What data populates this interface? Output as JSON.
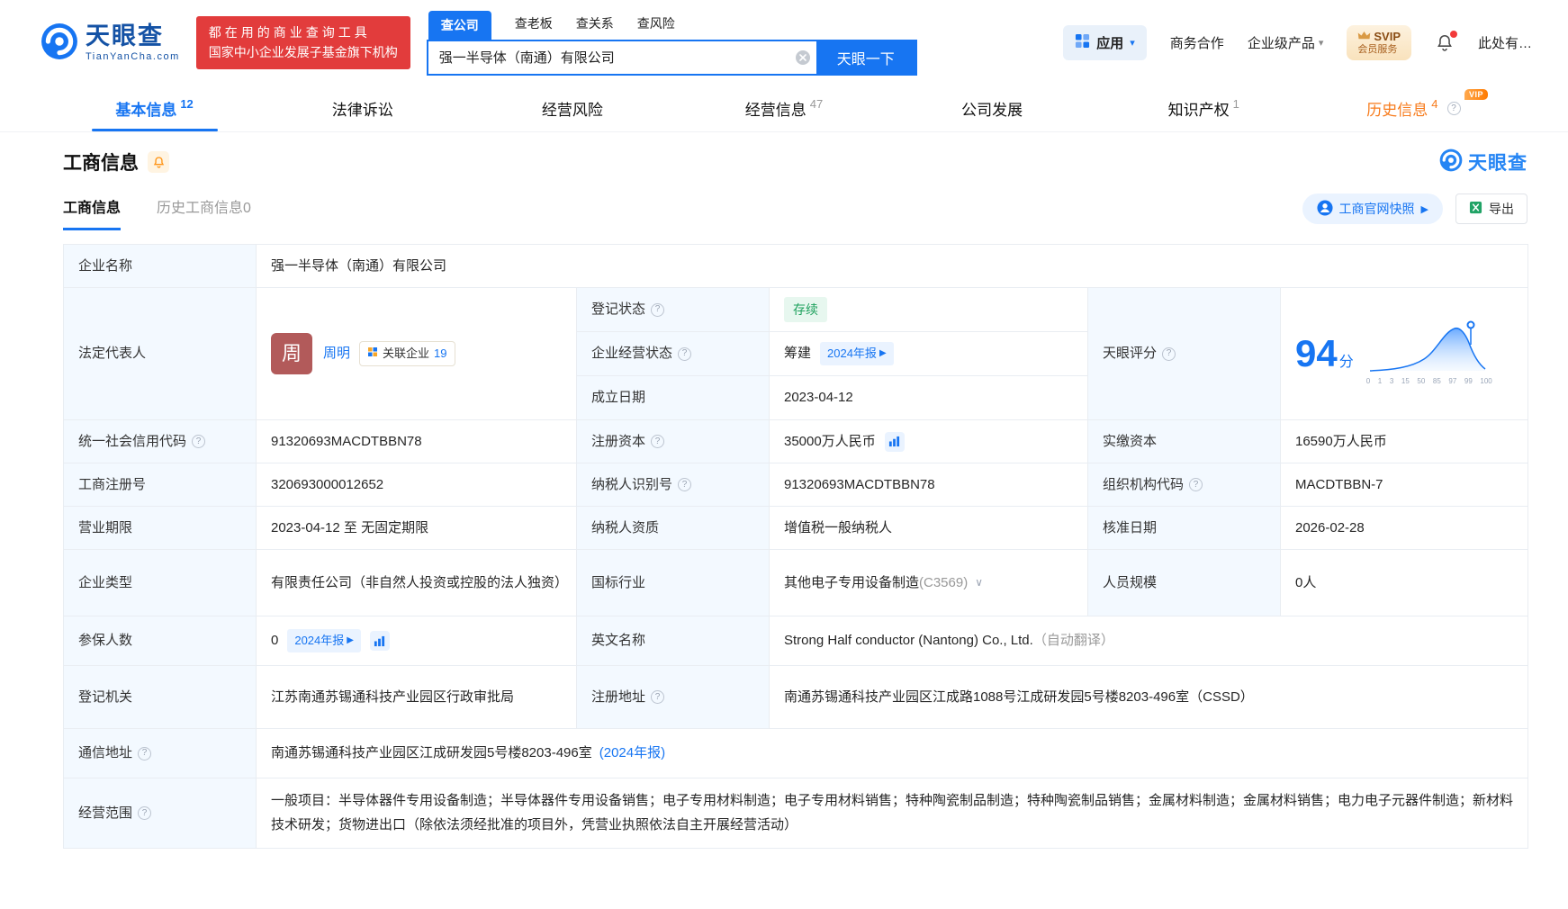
{
  "colors": {
    "accent": "#1775F2",
    "green": "#1EA15D",
    "orange": "#F77B1C",
    "red": "#E23C3C"
  },
  "header": {
    "logo": {
      "brand": "天眼查",
      "domain": "TianYanCha.com"
    },
    "slogan": {
      "line1": "都在用的商业查询工具",
      "line2": "国家中小企业发展子基金旗下机构"
    },
    "search": {
      "tabs": [
        {
          "label": "查公司"
        },
        {
          "label": "查老板"
        },
        {
          "label": "查关系"
        },
        {
          "label": "查风险"
        }
      ],
      "value": "强一半导体（南通）有限公司",
      "button": "天眼一下"
    },
    "menu": {
      "apps": "应用",
      "cooperation": "商务合作",
      "enterprise": "企业级产品",
      "svip_line1": "SVIP",
      "svip_line2": "会员服务",
      "more": "此处有…"
    }
  },
  "nav_tabs": [
    {
      "label": "基本信息",
      "count": "12"
    },
    {
      "label": "法律诉讼",
      "count": ""
    },
    {
      "label": "经营风险",
      "count": ""
    },
    {
      "label": "经营信息",
      "count": "47"
    },
    {
      "label": "公司发展",
      "count": ""
    },
    {
      "label": "知识产权",
      "count": "1"
    },
    {
      "label": "历史信息",
      "count": "4",
      "vip_tag": "VIP"
    }
  ],
  "section": {
    "title": "工商信息",
    "watermark": "天眼查"
  },
  "subtabs": {
    "current": "工商信息",
    "history": "历史工商信息0",
    "snapshot_button": "工商官网快照",
    "export_button": "导出"
  },
  "table": {
    "company_name_label": "企业名称",
    "company_name": "强一半导体（南通）有限公司",
    "legal_rep_label": "法定代表人",
    "legal_rep_avatar": "周",
    "legal_rep_name": "周明",
    "related_companies_label": "关联企业",
    "related_companies_count": "19",
    "reg_status_label": "登记状态",
    "reg_status": "存续",
    "operating_status_label": "企业经营状态",
    "operating_status": "筹建",
    "annual_report_badge": "2024年报",
    "establish_date_label": "成立日期",
    "establish_date": "2023-04-12",
    "score_label": "天眼评分",
    "score": "94",
    "score_unit": "分",
    "score_axis": [
      "0",
      "1",
      "3",
      "15",
      "50",
      "85",
      "97",
      "99",
      "100"
    ],
    "credit_code_label": "统一社会信用代码",
    "credit_code": "91320693MACDTBBN78",
    "reg_capital_label": "注册资本",
    "reg_capital": "35000万人民币",
    "paid_capital_label": "实缴资本",
    "paid_capital": "16590万人民币",
    "reg_number_label": "工商注册号",
    "reg_number": "320693000012652",
    "taxpayer_id_label": "纳税人识别号",
    "taxpayer_id": "91320693MACDTBBN78",
    "org_code_label": "组织机构代码",
    "org_code": "MACDTBBN-7",
    "business_term_label": "营业期限",
    "business_term": "2023-04-12 至 无固定期限",
    "taxpayer_quality_label": "纳税人资质",
    "taxpayer_quality": "增值税一般纳税人",
    "approval_date_label": "核准日期",
    "approval_date": "2026-02-28",
    "company_type_label": "企业类型",
    "company_type": "有限责任公司（非自然人投资或控股的法人独资）",
    "industry_label": "国标行业",
    "industry": "其他电子专用设备制造",
    "industry_code": "(C3569)",
    "staff_size_label": "人员规模",
    "staff_size": "0人",
    "insured_label": "参保人数",
    "insured": "0",
    "english_name_label": "英文名称",
    "english_name": "Strong Half conductor (Nantong) Co., Ltd.",
    "english_name_note": "（自动翻译）",
    "registry_label": "登记机关",
    "registry": "江苏南通苏锡通科技产业园区行政审批局",
    "reg_address_label": "注册地址",
    "reg_address": "南通苏锡通科技产业园区江成路1088号江成研发园5号楼8203-496室（CSSD）",
    "mail_address_label": "通信地址",
    "mail_address": "南通苏锡通科技产业园区江成研发园5号楼8203-496室",
    "mail_address_link": "(2024年报)",
    "business_scope_label": "经营范围",
    "business_scope": "一般项目：半导体器件专用设备制造；半导体器件专用设备销售；电子专用材料制造；电子专用材料销售；特种陶瓷制品制造；特种陶瓷制品销售；金属材料制造；金属材料销售；电力电子元器件制造；新材料技术研发；货物进出口（除依法须经批准的项目外，凭营业执照依法自主开展经营活动）"
  }
}
